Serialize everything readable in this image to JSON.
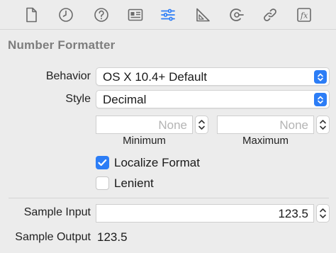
{
  "toolbar": {
    "icons": [
      "file-inspector-icon",
      "history-icon",
      "help-icon",
      "identity-icon",
      "attributes-icon",
      "size-icon",
      "connections-icon",
      "bindings-icon",
      "effects-icon"
    ],
    "accent": "#2c7df6"
  },
  "section": {
    "title": "Number Formatter"
  },
  "behavior": {
    "label": "Behavior",
    "value": "OS X 10.4+ Default"
  },
  "style": {
    "label": "Style",
    "value": "Decimal"
  },
  "minimum": {
    "placeholder": "None",
    "caption": "Minimum"
  },
  "maximum": {
    "placeholder": "None",
    "caption": "Maximum"
  },
  "localize": {
    "label": "Localize Format",
    "checked": true
  },
  "lenient": {
    "label": "Lenient",
    "checked": false
  },
  "sample_input": {
    "label": "Sample Input",
    "value": "123.5"
  },
  "sample_output": {
    "label": "Sample Output",
    "value": "123.5"
  }
}
